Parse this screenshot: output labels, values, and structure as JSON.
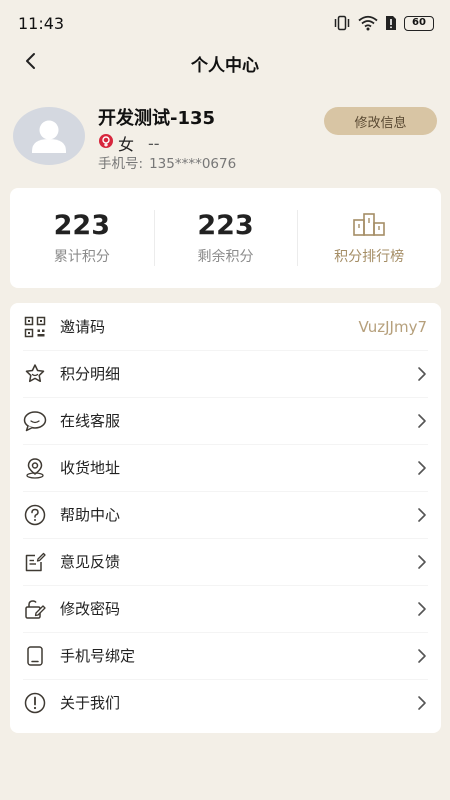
{
  "status_bar": {
    "time": "11:43",
    "battery": "60",
    "icons": [
      "vibrate-icon",
      "wifi-icon",
      "sim-alert-icon",
      "battery-icon"
    ]
  },
  "nav": {
    "title": "个人中心",
    "back_icon": "chevron-left-icon"
  },
  "profile": {
    "name": "开发测试-135",
    "gender": "女",
    "gender_extra": "--",
    "phone_label": "手机号:",
    "phone": "135****0676",
    "edit_button": "修改信息",
    "avatar_icon": "default-avatar-icon"
  },
  "stats": {
    "total_points": {
      "value": "223",
      "label": "累计积分"
    },
    "remaining_points": {
      "value": "223",
      "label": "剩余积分"
    },
    "leaderboard": {
      "label": "积分排行榜",
      "icon": "podium-icon"
    }
  },
  "menu": {
    "items": [
      {
        "label": "邀请码",
        "value": "VuzJJmy7",
        "icon": "qr-code-icon"
      },
      {
        "label": "积分明细",
        "icon": "star-icon"
      },
      {
        "label": "在线客服",
        "icon": "chat-bubble-icon"
      },
      {
        "label": "收货地址",
        "icon": "location-icon"
      },
      {
        "label": "帮助中心",
        "icon": "question-icon"
      },
      {
        "label": "意见反馈",
        "icon": "feedback-icon"
      },
      {
        "label": "修改密码",
        "icon": "edit-lock-icon"
      },
      {
        "label": "手机号绑定",
        "icon": "phone-icon"
      },
      {
        "label": "关于我们",
        "icon": "info-icon"
      }
    ]
  },
  "colors": {
    "background": "#f3efe7",
    "accent": "#a58e66",
    "button_bg": "#d8c5a4",
    "icon_stroke": "#3f3a33"
  }
}
